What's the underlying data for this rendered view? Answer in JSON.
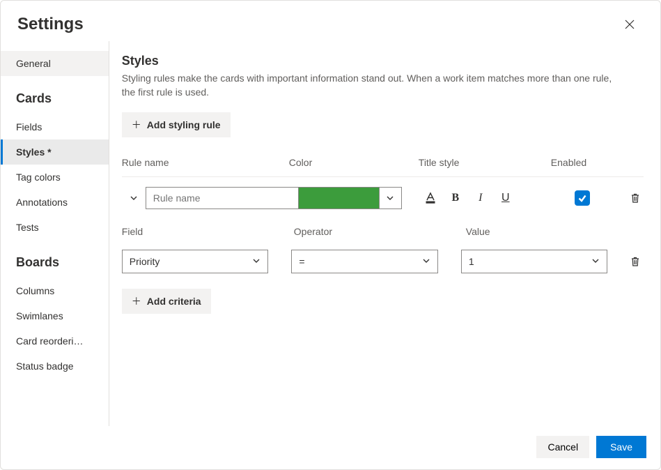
{
  "dialog": {
    "title": "Settings"
  },
  "sidebar": {
    "general": "General",
    "groups": [
      {
        "label": "Cards",
        "items": [
          "Fields",
          "Styles *",
          "Tag colors",
          "Annotations",
          "Tests"
        ],
        "selectedIndex": 1
      },
      {
        "label": "Boards",
        "items": [
          "Columns",
          "Swimlanes",
          "Card reorderi…",
          "Status badge"
        ]
      }
    ]
  },
  "styles": {
    "heading": "Styles",
    "description": "Styling rules make the cards with important information stand out. When a work item matches more than one rule, the first rule is used.",
    "addRuleLabel": "Add styling rule",
    "columns": {
      "ruleName": "Rule name",
      "color": "Color",
      "titleStyle": "Title style",
      "enabled": "Enabled"
    },
    "rule": {
      "namePlaceholder": "Rule name",
      "colorHex": "#3c9c3c",
      "enabled": true
    },
    "criteriaColumns": {
      "field": "Field",
      "operator": "Operator",
      "value": "Value"
    },
    "criteria": {
      "field": "Priority",
      "operator": "=",
      "value": "1"
    },
    "addCriteriaLabel": "Add criteria"
  },
  "footer": {
    "cancel": "Cancel",
    "save": "Save"
  }
}
